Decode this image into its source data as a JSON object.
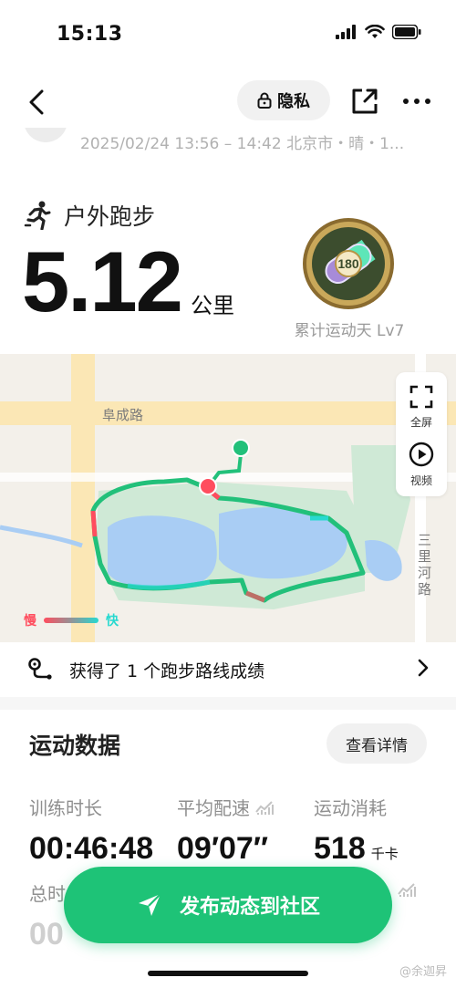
{
  "status": {
    "time": "15:13"
  },
  "nav": {
    "privacy_label": "隐私"
  },
  "meta": {
    "text": "2025/02/24 13:56 – 14:42 北京市・晴・1..."
  },
  "header": {
    "sport_name": "户外跑步",
    "distance_value": "5.12",
    "distance_unit": "公里",
    "medal_number": "180",
    "medal_label": "累计运动天 Lv7"
  },
  "map": {
    "road_fucheng": "阜成路",
    "road_sanlihe": "三里河路",
    "fullscreen_label": "全屏",
    "video_label": "视频",
    "legend_slow": "慢",
    "legend_fast": "快",
    "colors": {
      "route": "#22c07a",
      "slow": "#ff4d5e",
      "fast": "#27d9d0",
      "water": "#a9cdf4",
      "park": "#cfe9d6"
    }
  },
  "achievement": {
    "text": "获得了 1 个跑步路线成绩"
  },
  "stats": {
    "title": "运动数据",
    "detail_label": "查看详情",
    "items": [
      {
        "label": "训练时长",
        "value": "00:46:48",
        "unit": ""
      },
      {
        "label": "平均配速",
        "value": "09′07″",
        "unit": ""
      },
      {
        "label": "运动消耗",
        "value": "518",
        "unit": "千卡"
      }
    ],
    "row2_label_fragment": "总时",
    "row2_value_fragment": "00"
  },
  "publish": {
    "label": "发布动态到社区",
    "color": "#1ec377"
  },
  "watermark": "@余迦昇"
}
